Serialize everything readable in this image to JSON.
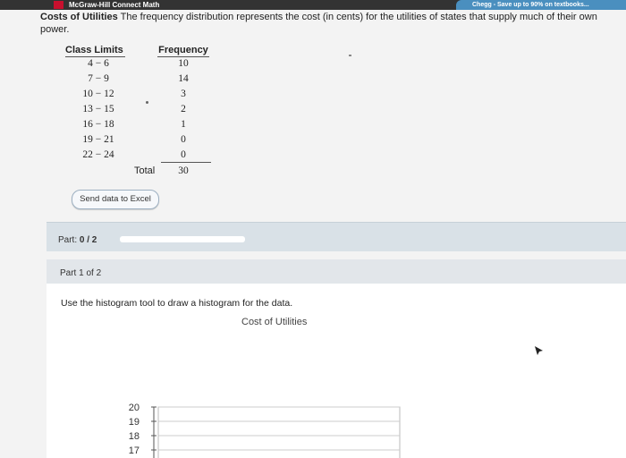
{
  "topbar": {
    "title": "McGraw-Hill Connect Math",
    "right_tab": "Chegg - Save up to 90% on textbooks..."
  },
  "problem": {
    "title": "Costs of Utilities",
    "text": "The frequency distribution represents the cost (in cents) for the utilities of states that supply much of their own power."
  },
  "table": {
    "header_class": "Class Limits",
    "header_freq": "Frequency",
    "rows": [
      {
        "limits": "4 − 6",
        "freq": "10"
      },
      {
        "limits": "7 − 9",
        "freq": "14"
      },
      {
        "limits": "10 − 12",
        "freq": "3"
      },
      {
        "limits": "13 − 15",
        "freq": "2"
      },
      {
        "limits": "16 − 18",
        "freq": "1"
      },
      {
        "limits": "19 − 21",
        "freq": "0"
      },
      {
        "limits": "22 − 24",
        "freq": "0"
      }
    ],
    "total_label": "Total",
    "total_value": "30"
  },
  "excel_button": "Send data to Excel",
  "part": {
    "label": "Part:",
    "value": "0 / 2",
    "progress": 0
  },
  "part1": {
    "label": "Part 1 of 2"
  },
  "question": {
    "instruction": "Use the histogram tool to draw a histogram for the data.",
    "chart_title": "Cost of Utilities"
  },
  "chart_data": {
    "type": "bar",
    "title": "Cost of Utilities",
    "y_ticks": [
      20,
      19,
      18,
      17
    ],
    "categories": [],
    "values": []
  }
}
